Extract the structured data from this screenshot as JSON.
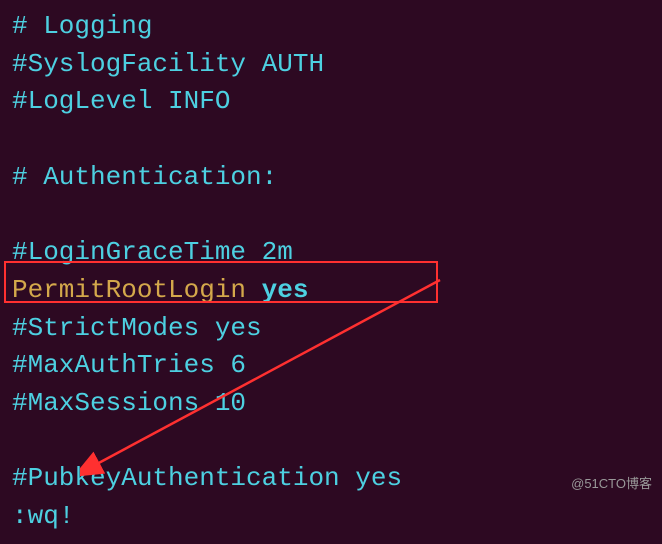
{
  "lines": {
    "l1": "# Logging",
    "l2": "#SyslogFacility AUTH",
    "l3": "#LogLevel INFO",
    "l4": "",
    "l5": "# Authentication:",
    "l6": "",
    "l7": "#LoginGraceTime 2m",
    "l8_key": "PermitRootLogin ",
    "l8_value": "yes",
    "l9": "#StrictModes yes",
    "l10": "#MaxAuthTries 6",
    "l11": "#MaxSessions 10",
    "l12": "",
    "l13": "#PubkeyAuthentication yes",
    "l14": ":wq!"
  },
  "watermark": "@51CTO博客"
}
